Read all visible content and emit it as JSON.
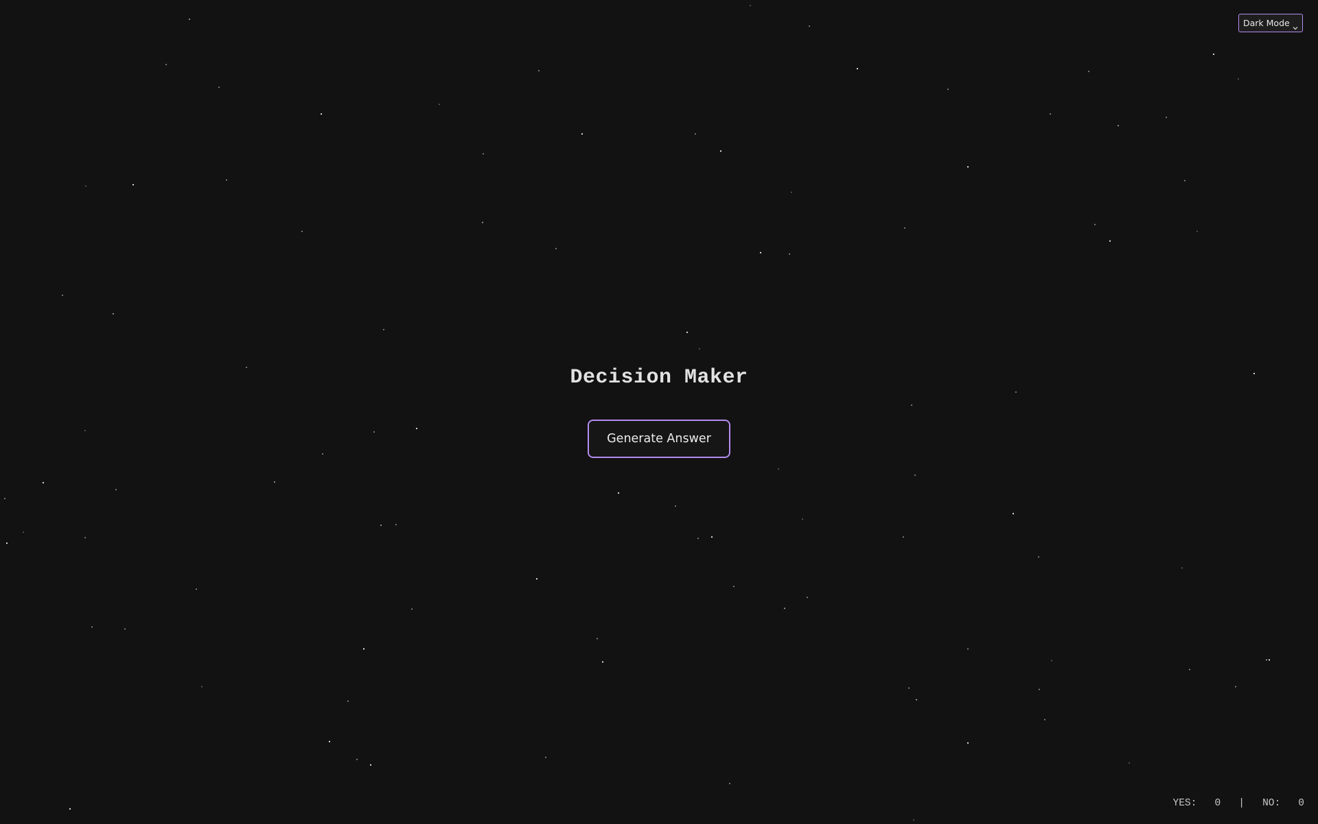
{
  "app": {
    "title": "Decision Maker",
    "generate_label": "Generate Answer"
  },
  "theme_select": {
    "selected": "Dark Mode",
    "icon": "chevron-down-icon"
  },
  "counter": {
    "yes_label": "YES:",
    "yes_count": "0",
    "separator": "|",
    "no_label": "NO:",
    "no_count": "0"
  },
  "colors": {
    "background": "#121212",
    "accent": "#b68cf0",
    "text": "#e2e2e2",
    "star": "#ffffff"
  }
}
